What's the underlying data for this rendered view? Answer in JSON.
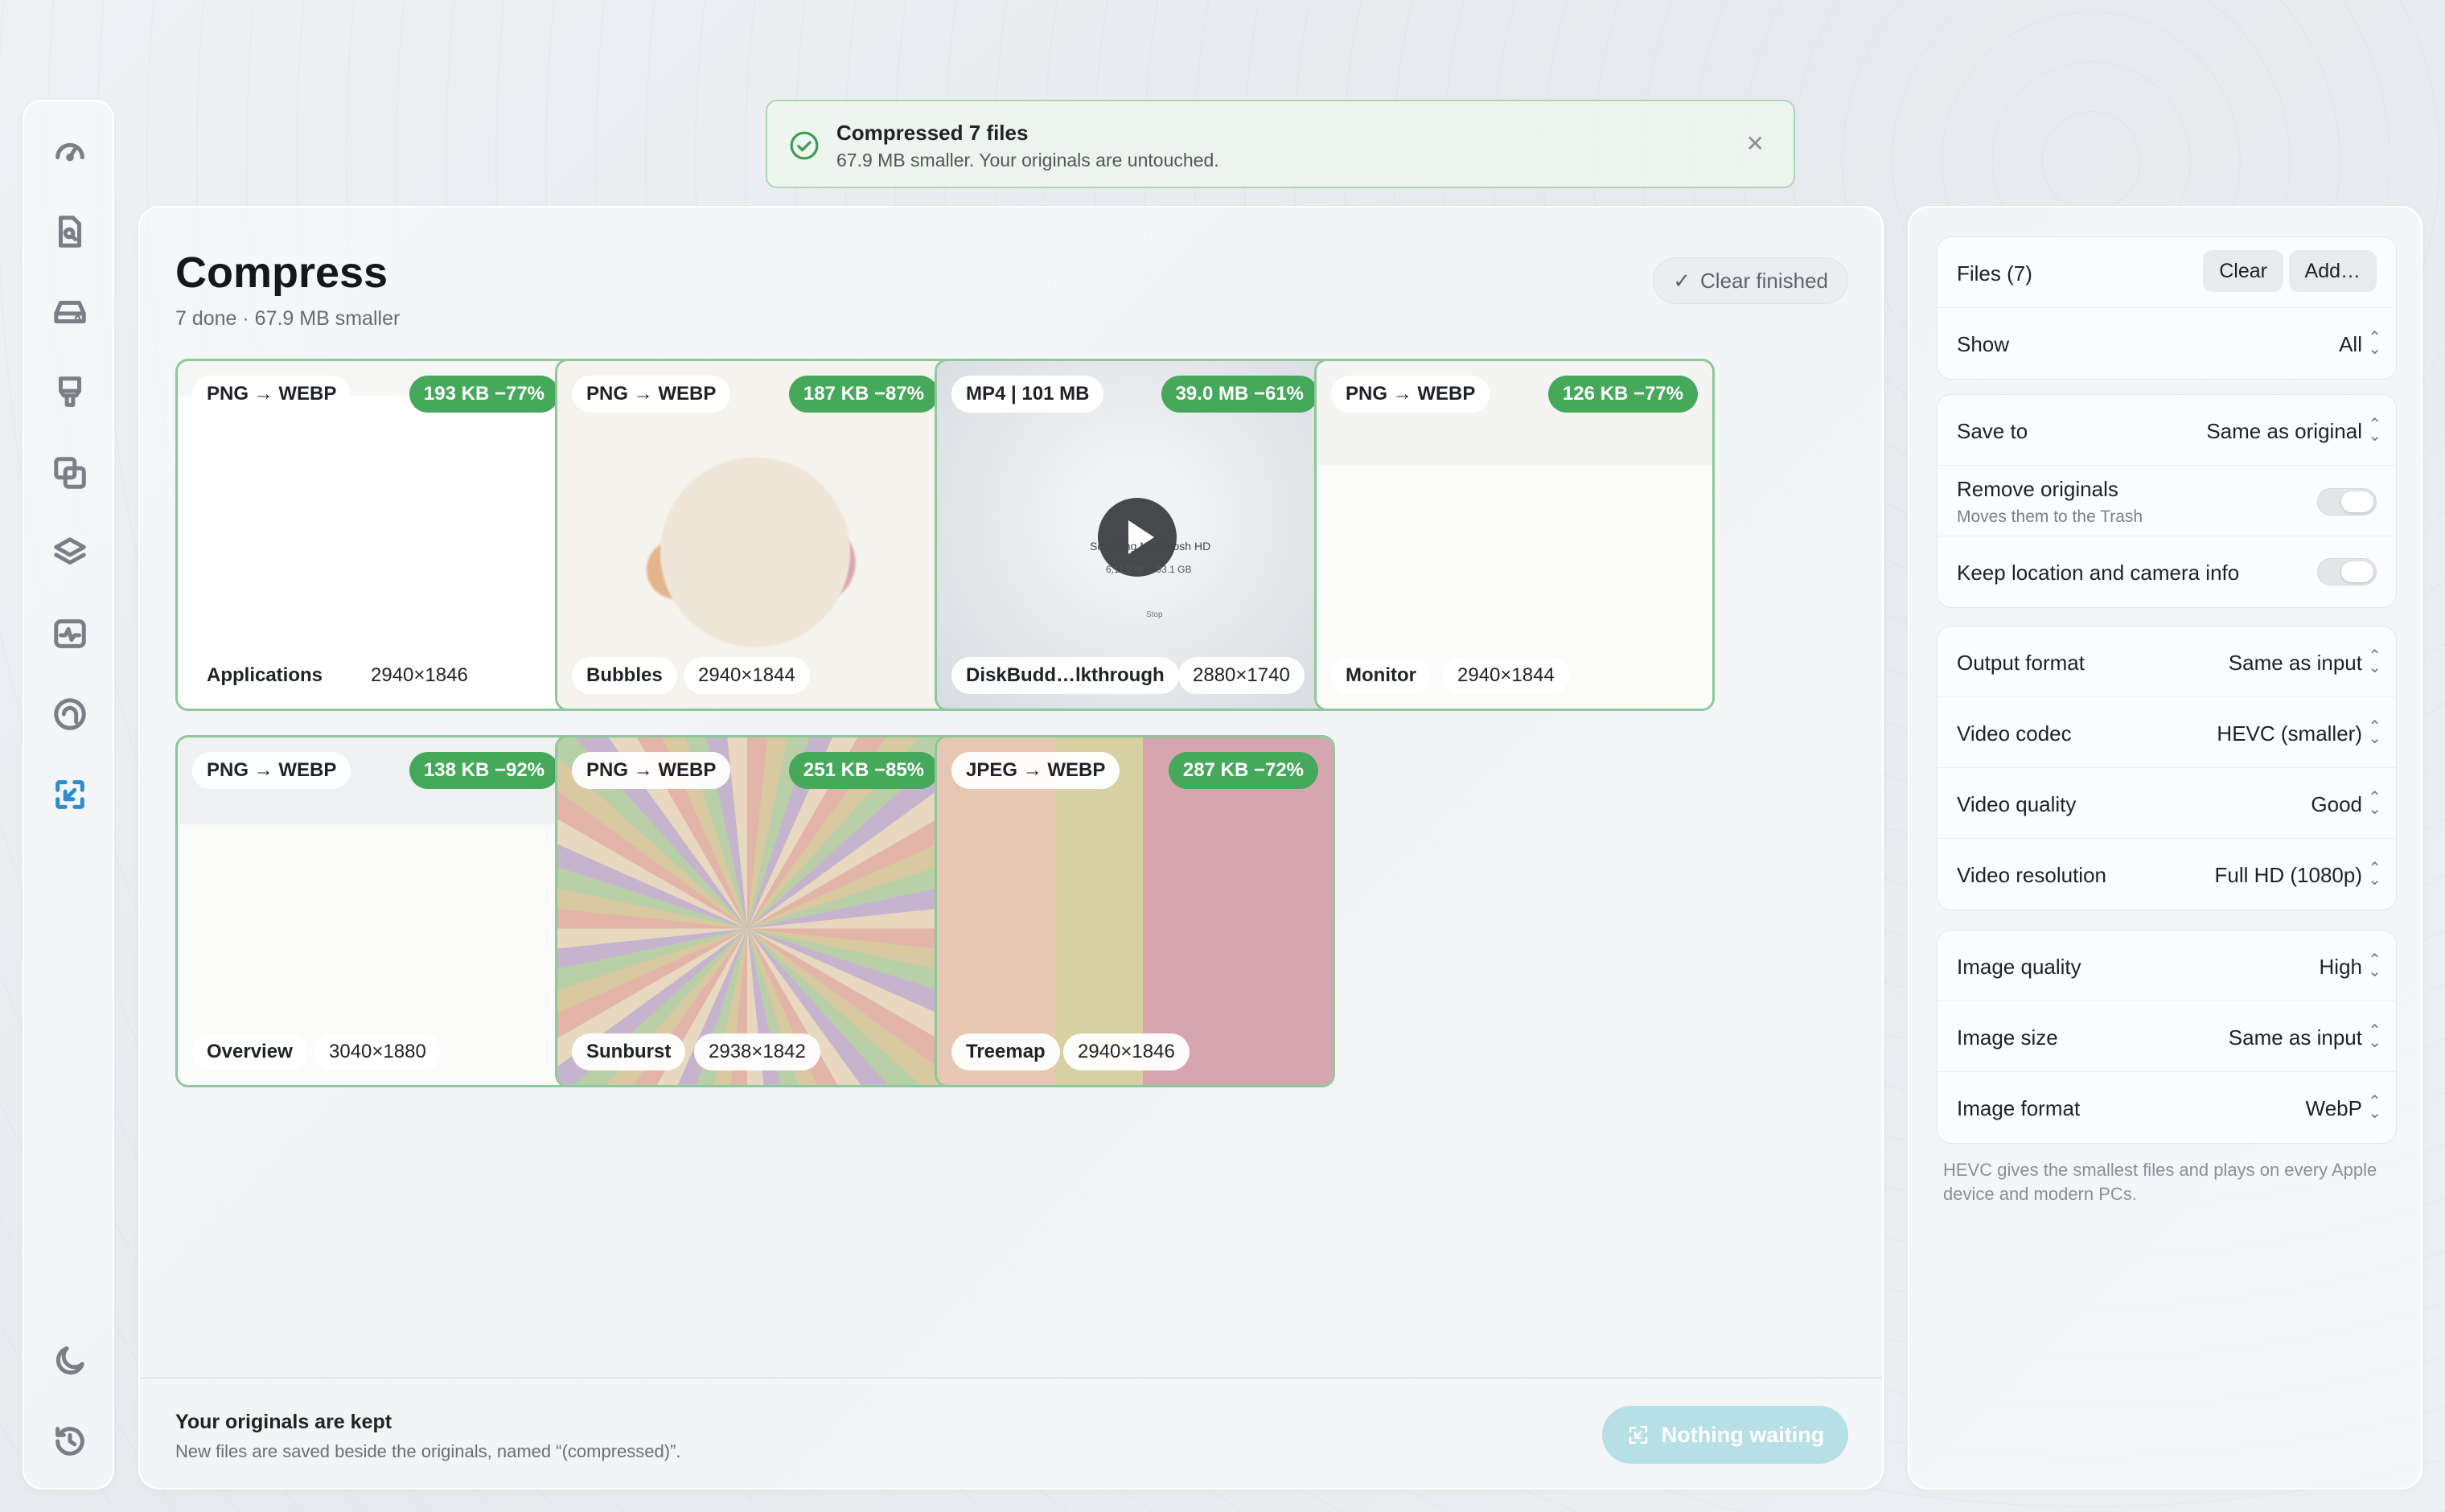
{
  "toast": {
    "title": "Compressed 7 files",
    "message": "67.9 MB smaller. Your originals are untouched."
  },
  "main": {
    "title": "Compress",
    "subtitle": "7 done · 67.9 MB smaller",
    "clear_finished": "Clear finished"
  },
  "files": [
    {
      "conversion": "PNG → WEBP",
      "result": "193 KB  −77%",
      "name": "Applications",
      "size": "2940×1846",
      "thumb": "table"
    },
    {
      "conversion": "PNG → WEBP",
      "result": "187 KB  −87%",
      "name": "Bubbles",
      "size": "2940×1844",
      "thumb": "bubbles"
    },
    {
      "conversion": "MP4 | 101 MB",
      "result": "39.0 MB  −61%",
      "name": "DiskBudd…lkthrough",
      "size": "2880×1740",
      "thumb": "video"
    },
    {
      "conversion": "PNG → WEBP",
      "result": "126 KB  −77%",
      "name": "Monitor",
      "size": "2940×1844",
      "thumb": "monitor"
    },
    {
      "conversion": "PNG → WEBP",
      "result": "138 KB  −92%",
      "name": "Overview",
      "size": "3040×1880",
      "thumb": "overview"
    },
    {
      "conversion": "PNG → WEBP",
      "result": "251 KB  −85%",
      "name": "Sunburst",
      "size": "2938×1842",
      "thumb": "sunburst"
    },
    {
      "conversion": "JPEG → WEBP",
      "result": "287 KB  −72%",
      "name": "Treemap",
      "size": "2940×1846",
      "thumb": "treemap"
    }
  ],
  "video_overlay": {
    "line1": "Scanning Macintosh HD",
    "stat1": "6,11,270",
    "stat2": "93.1 GB",
    "stop": "Stop"
  },
  "footer": {
    "title": "Your originals are kept",
    "subtitle": "New files are saved beside the originals, named “(compressed)”.",
    "action": "Nothing waiting"
  },
  "panel": {
    "files_label": "Files (7)",
    "clear": "Clear",
    "add": "Add…",
    "show_label": "Show",
    "show_value": "All",
    "save_to_label": "Save to",
    "save_to_value": "Same as original",
    "remove_label": "Remove originals",
    "remove_sub": "Moves them to the Trash",
    "keep_label": "Keep location and camera info",
    "output_format_label": "Output format",
    "output_format_value": "Same as input",
    "video_codec_label": "Video codec",
    "video_codec_value": "HEVC (smaller)",
    "video_quality_label": "Video quality",
    "video_quality_value": "Good",
    "video_resolution_label": "Video resolution",
    "video_resolution_value": "Full HD (1080p)",
    "image_quality_label": "Image quality",
    "image_quality_value": "High",
    "image_size_label": "Image size",
    "image_size_value": "Same as input",
    "image_format_label": "Image format",
    "image_format_value": "WebP",
    "note": "HEVC gives the smallest files and plays on every Apple device and modern PCs."
  },
  "toggles": {
    "remove_originals": false,
    "keep_location": false
  },
  "sidebar": {
    "icons": [
      "gauge-icon",
      "document-search-icon",
      "disk-icon",
      "cleanup-icon",
      "duplicates-icon",
      "layers-icon",
      "activity-icon",
      "app-icon",
      "compress-icon"
    ],
    "active": "compress-icon",
    "bottom": [
      "moon-icon",
      "history-icon"
    ]
  },
  "colors": {
    "accent": "#2d8ccf",
    "success": "#45a85a",
    "success_border": "#8fc79b"
  }
}
